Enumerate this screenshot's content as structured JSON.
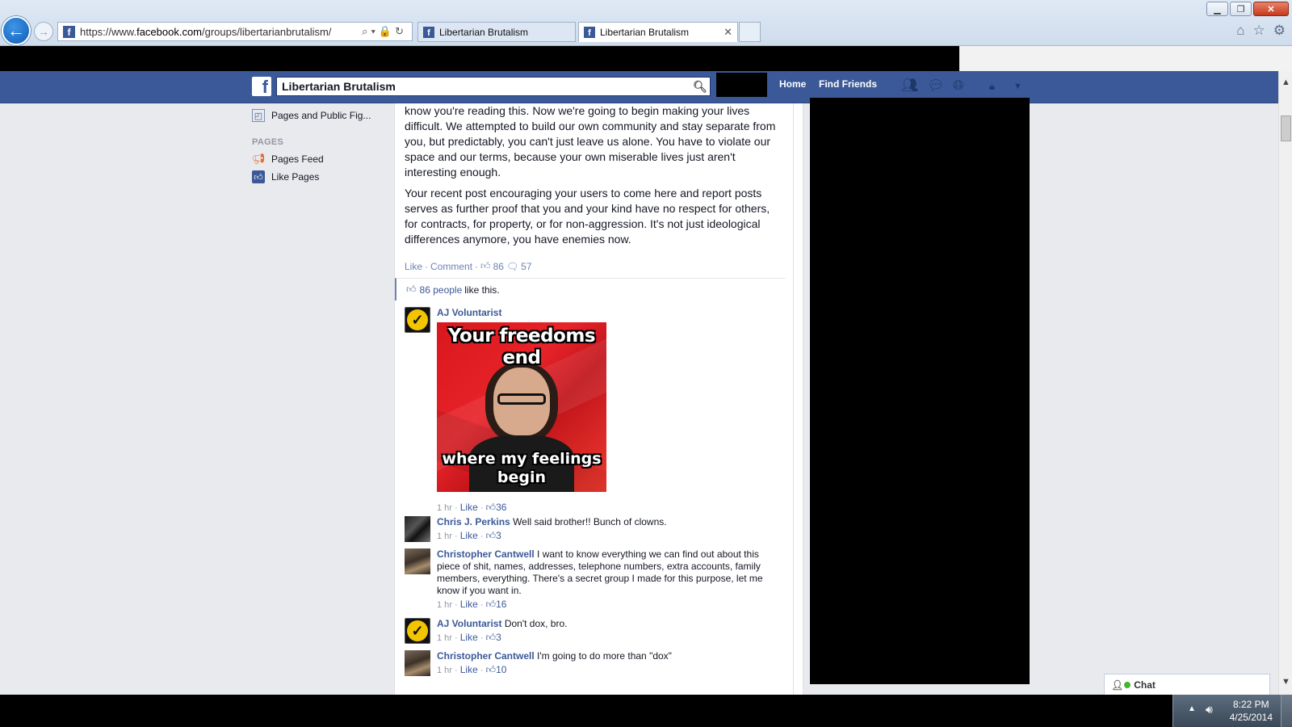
{
  "browser": {
    "url_prefix": "https://www.",
    "url_domain": "facebook.com",
    "url_path": "/groups/libertarianbrutalism/",
    "tabs": [
      {
        "label": "Libertarian Brutalism"
      },
      {
        "label": "Libertarian Brutalism"
      }
    ]
  },
  "fb": {
    "search_value": "Libertarian Brutalism",
    "nav": {
      "home": "Home",
      "find_friends": "Find Friends"
    }
  },
  "sidebar": {
    "top_item": "Pages and Public Fig...",
    "pages_header": "PAGES",
    "items": [
      {
        "label": "Pages Feed"
      },
      {
        "label": "Like Pages"
      }
    ]
  },
  "post": {
    "paragraphs": [
      "know you're reading this. Now we're going to begin making your lives difficult. We attempted to build our own community and stay separate from you, but predictably, you can't just leave us alone. You have to violate our space and our terms, because your own miserable lives just aren't interesting enough.",
      "Your recent post encouraging your users to come here and report posts serves as further proof that you and your kind have no respect for others, for contracts, for property, or for non-aggression. It's not just ideological differences anymore, you have enemies now."
    ],
    "actions": {
      "like": "Like",
      "comment": "Comment",
      "like_count": "86",
      "comment_count": "57"
    },
    "likes_summary": {
      "link": "86 people",
      "text": "like this."
    }
  },
  "comments": [
    {
      "name": "AJ Voluntarist",
      "text": "",
      "time": "1 hr",
      "like": "Like",
      "likes": "36",
      "meme": {
        "top": "Your freedoms end",
        "bottom": "where my feelings begin"
      }
    },
    {
      "name": "Chris J. Perkins",
      "text": "Well said brother!! Bunch of clowns.",
      "time": "1 hr",
      "like": "Like",
      "likes": "3"
    },
    {
      "name": "Christopher Cantwell",
      "text": "I want to know everything we can find out about this piece of shit, names, addresses, telephone numbers, extra accounts, family members, everything. There's a secret group I made for this purpose, let me know if you want in.",
      "time": "1 hr",
      "like": "Like",
      "likes": "16"
    },
    {
      "name": "AJ Voluntarist",
      "text": "Don't dox, bro.",
      "time": "1 hr",
      "like": "Like",
      "likes": "3"
    },
    {
      "name": "Christopher Cantwell",
      "text": "I'm going to do more than \"dox\"",
      "time": "1 hr",
      "like": "Like",
      "likes": "10"
    }
  ],
  "chat": {
    "label": "Chat"
  },
  "taskbar": {
    "time": "8:22 PM",
    "date": "4/25/2014"
  }
}
